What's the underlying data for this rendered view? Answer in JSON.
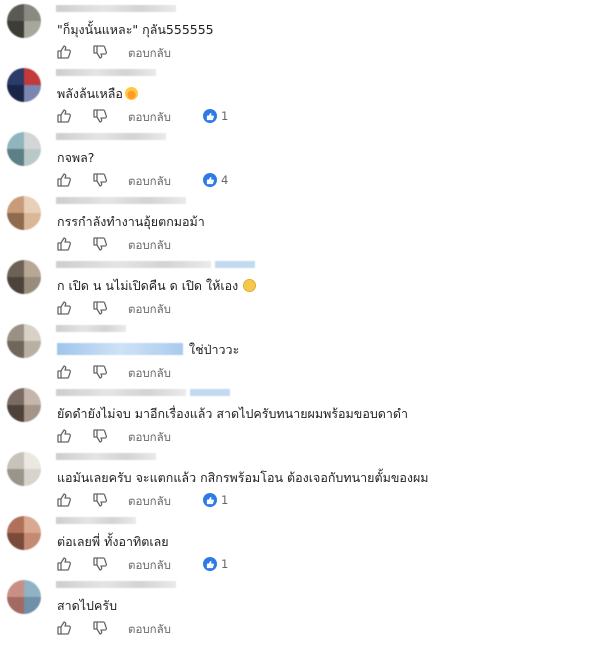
{
  "reply_label": "ตอบกลับ",
  "colors": {
    "accent": "#2d7be5",
    "muted": "#65676b"
  },
  "comments": [
    {
      "text": "\"ก็มุงนั้นแหละ\" กุลัน555555",
      "likes": ""
    },
    {
      "text": "พลังล้นเหลือ",
      "likes": "1"
    },
    {
      "text": "กจพล?",
      "likes": "4"
    },
    {
      "text": "กรรกำลังทำงานอุ้ยตกมอม้า",
      "likes": ""
    },
    {
      "text": "ก เปิด น นไม่เปิดคืน ด เปิด ให้เอง",
      "likes": ""
    },
    {
      "text": "ใช่ป่าววะ",
      "likes": ""
    },
    {
      "text": "ยัดดำยังไม่จบ มาอีกเรื่องแล้ว สาดไปครับทนายผมพร้อมขอบดาดำ",
      "likes": ""
    },
    {
      "text": "แอมันเลยครับ จะแตกแล้ว กสิกรพร้อมโอน ต้องเจอกับทนายตั้มของผม",
      "likes": "1"
    },
    {
      "text": "ต่อเลยพี่ ทั้งอาทิตเลย",
      "likes": "1"
    },
    {
      "text": "สาดไปครับ",
      "likes": ""
    }
  ]
}
